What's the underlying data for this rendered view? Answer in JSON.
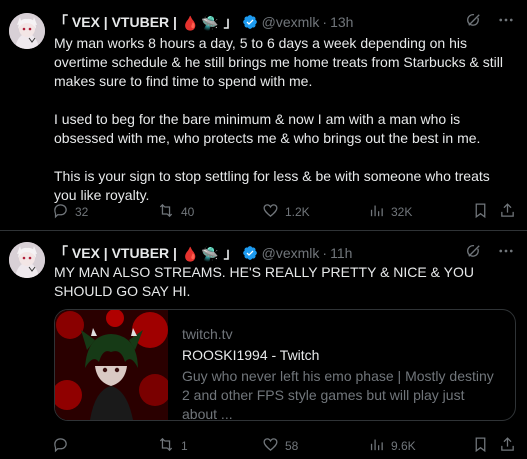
{
  "tweets": [
    {
      "author_name": "「 VEX | VTUBER |",
      "author_emoji_1": "🩸",
      "author_emoji_2": "🛸",
      "author_suffix": " 」",
      "handle": "@vexmlk",
      "separator": "·",
      "time": "13h",
      "paragraphs": [
        "My man works 8 hours a day, 5 to 6 days a week depending on his overtime schedule & he still brings me home treats from Starbucks & still makes sure to find time to spend with me.",
        "I used to beg for the bare minimum & now I am with a man who is obsessed with me, who protects me & who brings out the best in me.",
        "This is your sign to stop settling for less & be with someone who treats you like royalty."
      ],
      "replies": "32",
      "reposts": "40",
      "likes": "1.2K",
      "views": "32K"
    },
    {
      "author_name": "「 VEX | VTUBER |",
      "author_emoji_1": "🩸",
      "author_emoji_2": "🛸",
      "author_suffix": " 」",
      "handle": "@vexmlk",
      "separator": "·",
      "time": "11h",
      "paragraphs": [
        "MY MAN ALSO STREAMS. HE'S REALLY PRETTY & NICE & YOU SHOULD GO SAY HI."
      ],
      "card": {
        "domain": "twitch.tv",
        "title": "ROOSKI1994 - Twitch",
        "description": "Guy who never left his emo phase | Mostly destiny 2 and other FPS style games but will play just about ..."
      },
      "replies": "",
      "reposts": "1",
      "likes": "58",
      "views": "9.6K"
    }
  ],
  "icons": {
    "grok": "grok-icon",
    "more": "more-icon",
    "reply": "reply-icon",
    "repost": "repost-icon",
    "like": "like-icon",
    "views": "views-icon",
    "bookmark": "bookmark-icon",
    "share": "share-icon",
    "verified": "verified-badge-icon"
  },
  "colors": {
    "background": "#000000",
    "text": "#e7e9ea",
    "muted": "#71767b",
    "verified": "#1d9bf0",
    "border": "#2f3336"
  }
}
